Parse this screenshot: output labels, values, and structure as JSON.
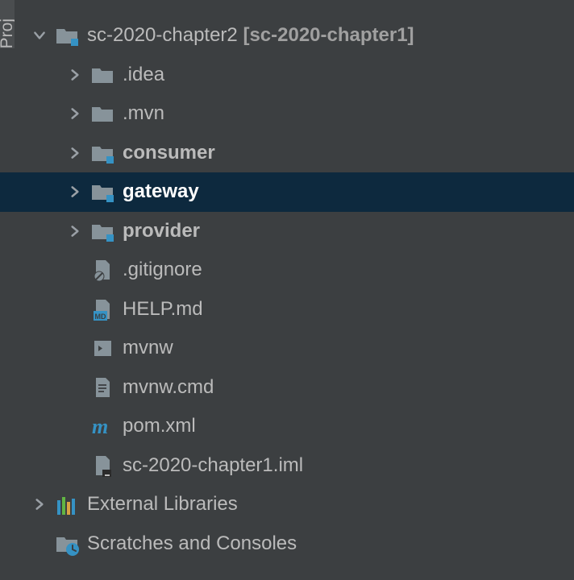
{
  "sidebarTab": "Proj",
  "tree": {
    "root": {
      "name": "sc-2020-chapter2",
      "context": "[sc-2020-chapter1]",
      "children": [
        {
          "label": ".idea",
          "type": "folder",
          "expandable": true
        },
        {
          "label": ".mvn",
          "type": "folder",
          "expandable": true
        },
        {
          "label": "consumer",
          "type": "module",
          "expandable": true,
          "bold": true
        },
        {
          "label": "gateway",
          "type": "module",
          "expandable": true,
          "bold": true,
          "selected": true
        },
        {
          "label": "provider",
          "type": "module",
          "expandable": true,
          "bold": true
        },
        {
          "label": ".gitignore",
          "type": "file-ignore",
          "expandable": false
        },
        {
          "label": "HELP.md",
          "type": "file-md",
          "expandable": false
        },
        {
          "label": "mvnw",
          "type": "file-exec",
          "expandable": false
        },
        {
          "label": "mvnw.cmd",
          "type": "file-text",
          "expandable": false
        },
        {
          "label": "pom.xml",
          "type": "file-maven",
          "expandable": false
        },
        {
          "label": "sc-2020-chapter1.iml",
          "type": "file-iml",
          "expandable": false
        }
      ]
    },
    "external": {
      "label": "External Libraries"
    },
    "scratches": {
      "label": "Scratches and Consoles"
    }
  }
}
